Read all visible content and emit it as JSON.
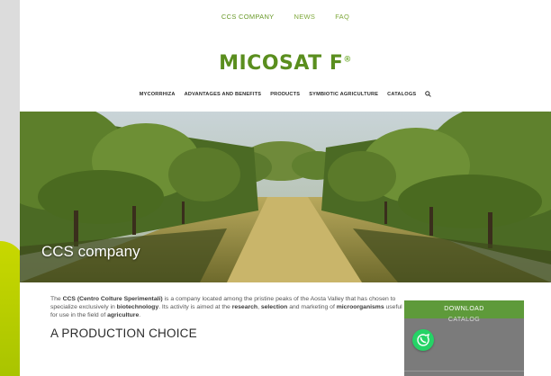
{
  "topnav": {
    "items": [
      {
        "label": "CCS COMPANY"
      },
      {
        "label": "NEWS"
      },
      {
        "label": "FAQ"
      }
    ]
  },
  "logo": {
    "text": "MICOSAT F",
    "mark": "®"
  },
  "menu": {
    "items": [
      {
        "label": "MYCORRHIZA"
      },
      {
        "label": "ADVANTAGES AND BENEFITS"
      },
      {
        "label": "PRODUCTS"
      },
      {
        "label": "SYMBIOTIC AGRICULTURE"
      },
      {
        "label": "CATALOGS"
      }
    ],
    "search_icon": "search-icon"
  },
  "hero": {
    "title": "CCS company"
  },
  "intro": {
    "p1": "The ",
    "ccs": "CCS (Centro Colture Sperimentali)",
    "p2": " is a company located among the pristine peaks of the Aosta Valley that has chosen to specialize exclusively in ",
    "biotech": "biotechnology",
    "p3": ". Its activity is aimed at the ",
    "research": "research",
    "p4": ", ",
    "selection": "selection",
    "p5": " and marketing of ",
    "micro": "microorganisms",
    "p6": " useful for use in the field of ",
    "agri": "agriculture",
    "p7": "."
  },
  "subhead": "A PRODUCTION CHOICE",
  "sidebar": {
    "download": "DOWNLOAD",
    "catalog": "CATALOG"
  },
  "colors": {
    "brand_green": "#5a8e1e",
    "nav_green": "#7ea83a",
    "button_green": "#5e9a3a",
    "whatsapp": "#25d366"
  }
}
